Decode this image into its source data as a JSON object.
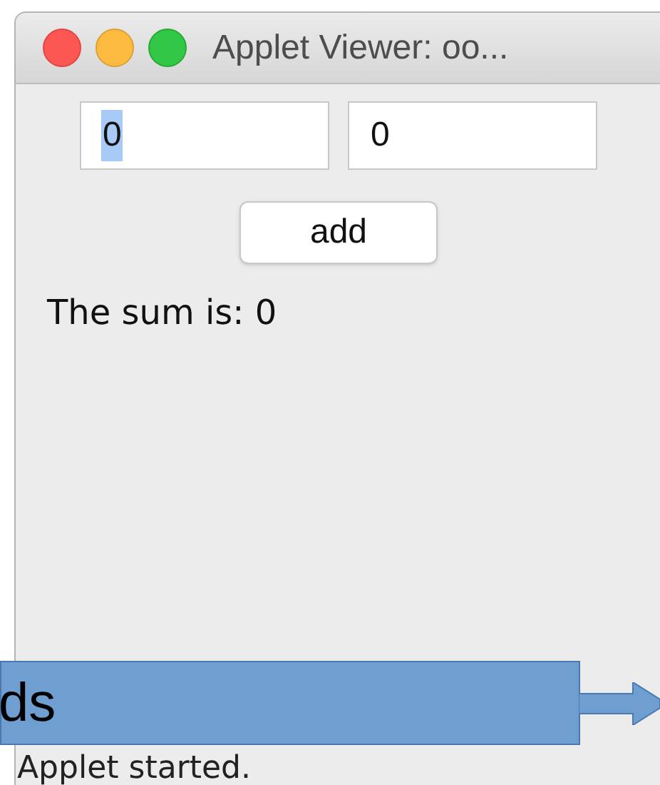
{
  "window": {
    "title": "Applet Viewer: oo..."
  },
  "fields": [
    {
      "value": "0",
      "text_selected": true
    },
    {
      "value": "0",
      "text_selected": false
    }
  ],
  "button": {
    "label": "add"
  },
  "result": "The sum is: 0",
  "status_bar": "Applet started.",
  "callout": {
    "text": "ds"
  }
}
